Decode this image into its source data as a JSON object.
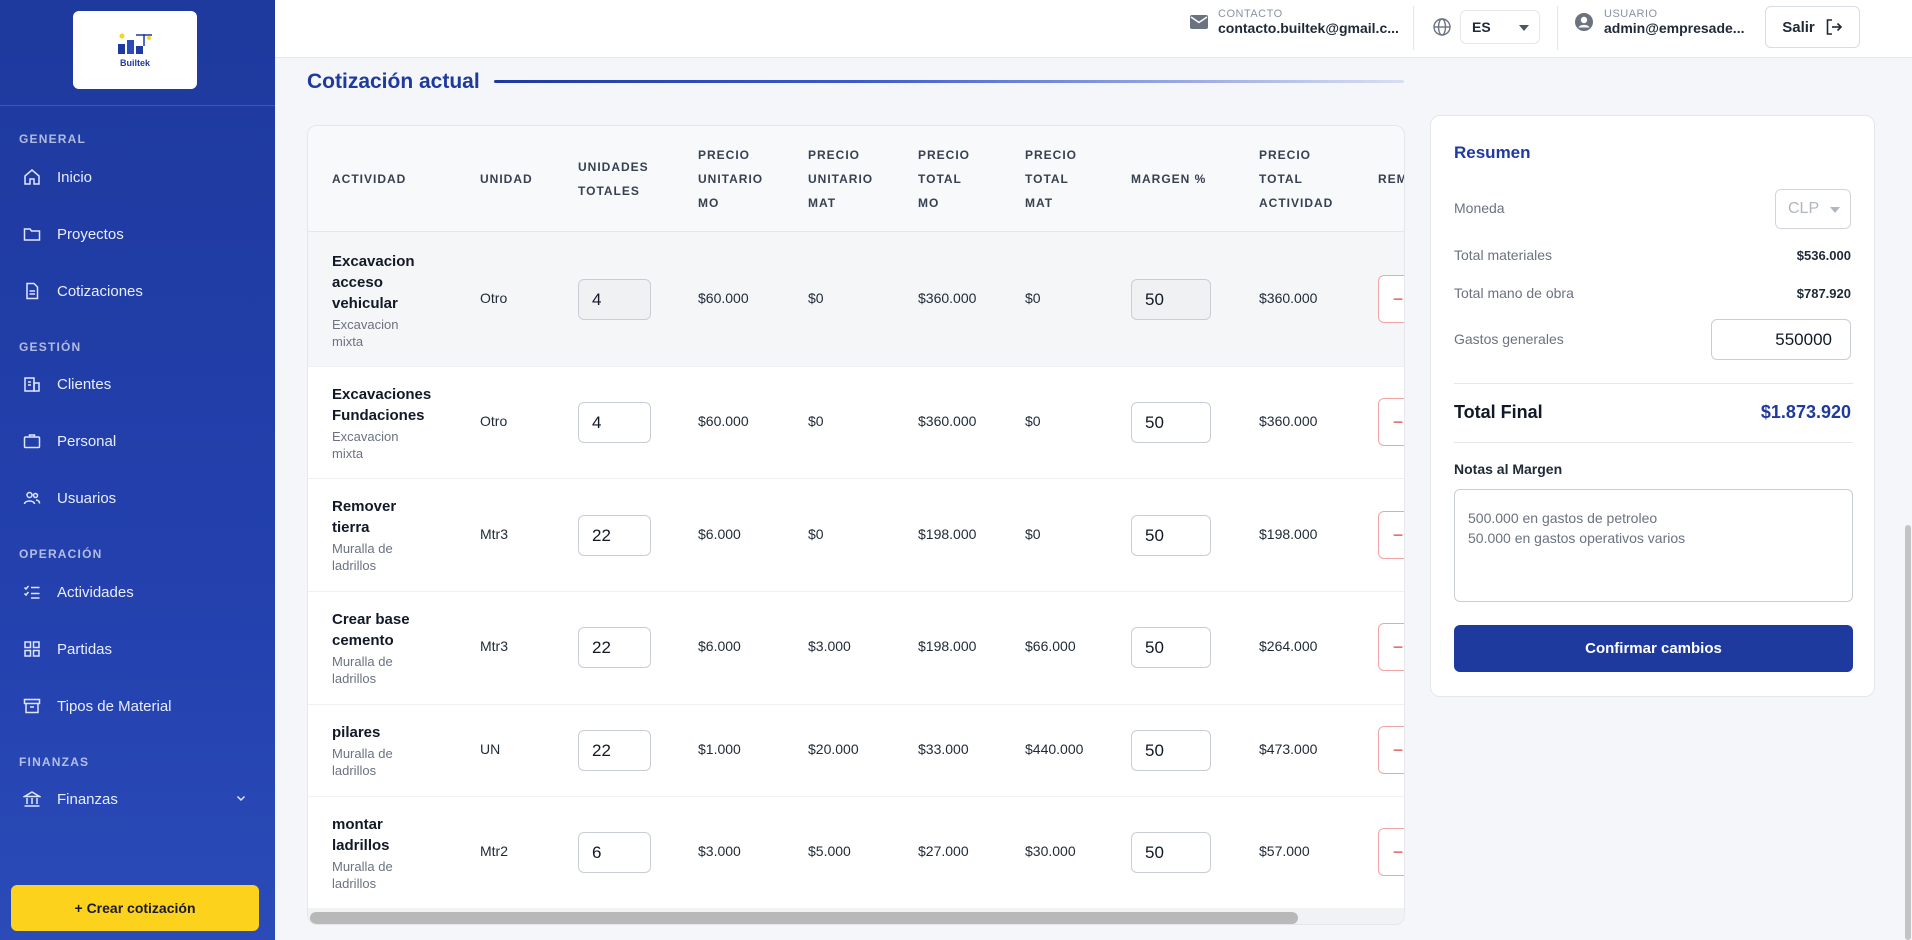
{
  "sidebar": {
    "logo_text": "Builtek",
    "sections": {
      "general": "GENERAL",
      "gestion": "GESTIÓN",
      "operacion": "OPERACIÓN",
      "finanzas": "FINANZAS"
    },
    "items": {
      "inicio": "Inicio",
      "proyectos": "Proyectos",
      "cotizaciones": "Cotizaciones",
      "clientes": "Clientes",
      "personal": "Personal",
      "usuarios": "Usuarios",
      "actividades": "Actividades",
      "partidas": "Partidas",
      "tipos_material": "Tipos de Material",
      "finanzas": "Finanzas"
    },
    "create_button": "+ Crear cotización"
  },
  "topbar": {
    "contact_label": "CONTACTO",
    "contact_value": "contacto.builtek@gmail.c...",
    "language": "ES",
    "user_label": "USUARIO",
    "user_value": "admin@empresade...",
    "logout": "Salir"
  },
  "main": {
    "heading": "Cotización actual",
    "columns": {
      "actividad": "ACTIVIDAD",
      "unidad": "UNIDAD",
      "unidades_1": "UNIDADES",
      "unidades_2": "TOTALES",
      "pumo_1": "PRECIO",
      "pumo_2": "UNITARIO",
      "pumo_3": "MO",
      "pumat_1": "PRECIO",
      "pumat_2": "UNITARIO",
      "pumat_3": "MAT",
      "ptmo_1": "PRECIO",
      "ptmo_2": "TOTAL",
      "ptmo_3": "MO",
      "ptmat_1": "PRECIO",
      "ptmat_2": "TOTAL",
      "ptmat_3": "MAT",
      "margen": "MARGEN %",
      "pta_1": "PRECIO",
      "pta_2": "TOTAL",
      "pta_3": "ACTIVIDAD",
      "rem": "REM"
    },
    "rows": [
      {
        "name": "Excavacion acceso vehicular",
        "sub": "Excavacion mixta",
        "unit": "Otro",
        "qty": "4",
        "pu_mo": "$60.000",
        "pu_mat": "$0",
        "pt_mo": "$360.000",
        "pt_mat": "$0",
        "margin": "50",
        "total": "$360.000"
      },
      {
        "name": "Excavaciones Fundaciones",
        "sub": "Excavacion mixta",
        "unit": "Otro",
        "qty": "4",
        "pu_mo": "$60.000",
        "pu_mat": "$0",
        "pt_mo": "$360.000",
        "pt_mat": "$0",
        "margin": "50",
        "total": "$360.000"
      },
      {
        "name": "Remover tierra",
        "sub": "Muralla de ladrillos",
        "unit": "Mtr3",
        "qty": "22",
        "pu_mo": "$6.000",
        "pu_mat": "$0",
        "pt_mo": "$198.000",
        "pt_mat": "$0",
        "margin": "50",
        "total": "$198.000"
      },
      {
        "name": "Crear base cemento",
        "sub": "Muralla de ladrillos",
        "unit": "Mtr3",
        "qty": "22",
        "pu_mo": "$6.000",
        "pu_mat": "$3.000",
        "pt_mo": "$198.000",
        "pt_mat": "$66.000",
        "margin": "50",
        "total": "$264.000"
      },
      {
        "name": "pilares",
        "sub": "Muralla de ladrillos",
        "unit": "UN",
        "qty": "22",
        "pu_mo": "$1.000",
        "pu_mat": "$20.000",
        "pt_mo": "$33.000",
        "pt_mat": "$440.000",
        "margin": "50",
        "total": "$473.000"
      },
      {
        "name": "montar ladrillos",
        "sub": "Muralla de ladrillos",
        "unit": "Mtr2",
        "qty": "6",
        "pu_mo": "$3.000",
        "pu_mat": "$5.000",
        "pt_mo": "$27.000",
        "pt_mat": "$30.000",
        "margin": "50",
        "total": "$57.000"
      }
    ],
    "remove_symbol": "−"
  },
  "summary": {
    "title": "Resumen",
    "currency_label": "Moneda",
    "currency_value": "CLP",
    "materials_label": "Total materiales",
    "materials_value": "$536.000",
    "labor_label": "Total mano de obra",
    "labor_value": "$787.920",
    "overhead_label": "Gastos generales",
    "overhead_value": "550000",
    "total_label": "Total Final",
    "total_value": "$1.873.920",
    "notes_label": "Notas al Margen",
    "notes_value": "500.000 en gastos de petroleo\n50.000 en gastos operativos varios",
    "confirm": "Confirmar cambios"
  },
  "colors": {
    "primary": "#1e3a9e",
    "accent": "#fcd21d",
    "danger": "#e04848"
  }
}
